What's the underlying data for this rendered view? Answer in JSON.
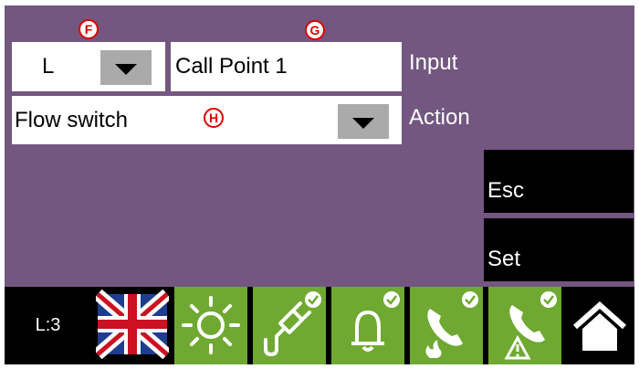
{
  "input_row": {
    "selector_value": "L",
    "name_value": "Call Point 1",
    "label": "Input"
  },
  "action_row": {
    "value": "Flow switch",
    "label": "Action"
  },
  "markers": {
    "f": "F",
    "g": "G",
    "h": "H"
  },
  "buttons": {
    "esc": "Esc",
    "set": "Set"
  },
  "status_bar": {
    "level": "L:3"
  },
  "colors": {
    "background": "#735781",
    "icon_tile": "#6fa931",
    "dropdown_button": "#aaaaaa"
  },
  "icons": [
    "uk-flag-icon",
    "sun-icon",
    "power-plug-icon",
    "bell-icon",
    "phone-fire-icon",
    "phone-warning-icon",
    "home-icon"
  ]
}
